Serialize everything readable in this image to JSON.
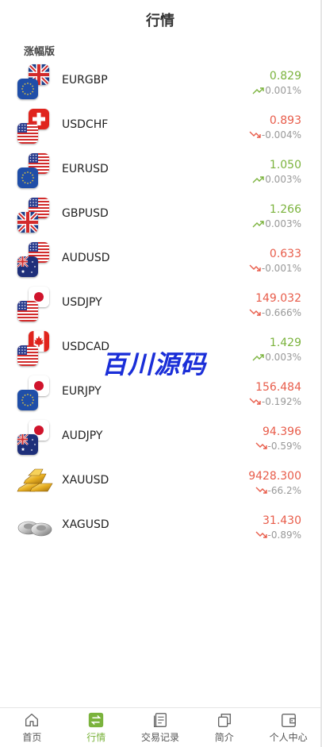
{
  "header": {
    "title": "行情"
  },
  "section": {
    "label": "涨幅版"
  },
  "watermark": "百川源码",
  "colors": {
    "up": "#7bb33d",
    "down": "#e85c4a",
    "accent": "#7bb33d"
  },
  "quotes": [
    {
      "symbol": "EURGBP",
      "price": "0.829",
      "change": "0.001%",
      "direction": "up",
      "icon": "eu-gb-flags-icon"
    },
    {
      "symbol": "USDCHF",
      "price": "0.893",
      "change": "-0.004%",
      "direction": "down",
      "icon": "us-ch-flags-icon"
    },
    {
      "symbol": "EURUSD",
      "price": "1.050",
      "change": "0.003%",
      "direction": "up",
      "icon": "eu-us-flags-icon"
    },
    {
      "symbol": "GBPUSD",
      "price": "1.266",
      "change": "0.003%",
      "direction": "up",
      "icon": "gb-us-flags-icon"
    },
    {
      "symbol": "AUDUSD",
      "price": "0.633",
      "change": "-0.001%",
      "direction": "down",
      "icon": "au-us-flags-icon"
    },
    {
      "symbol": "USDJPY",
      "price": "149.032",
      "change": "-0.666%",
      "direction": "down",
      "icon": "us-jp-flags-icon"
    },
    {
      "symbol": "USDCAD",
      "price": "1.429",
      "change": "0.003%",
      "direction": "up",
      "icon": "us-ca-flags-icon"
    },
    {
      "symbol": "EURJPY",
      "price": "156.484",
      "change": "-0.192%",
      "direction": "down",
      "icon": "eu-jp-flags-icon"
    },
    {
      "symbol": "AUDJPY",
      "price": "94.396",
      "change": "-0.59%",
      "direction": "down",
      "icon": "au-jp-flags-icon"
    },
    {
      "symbol": "XAUUSD",
      "price": "9428.300",
      "change": "-66.2%",
      "direction": "down",
      "icon": "gold-bars-icon"
    },
    {
      "symbol": "XAGUSD",
      "price": "31.430",
      "change": "-0.89%",
      "direction": "down",
      "icon": "silver-ingots-icon"
    }
  ],
  "tabbar": {
    "items": [
      {
        "label": "首页",
        "icon": "home-icon"
      },
      {
        "label": "行情",
        "icon": "exchange-icon",
        "active": true
      },
      {
        "label": "交易记录",
        "icon": "records-icon"
      },
      {
        "label": "简介",
        "icon": "copy-icon"
      },
      {
        "label": "个人中心",
        "icon": "wallet-icon"
      }
    ]
  }
}
